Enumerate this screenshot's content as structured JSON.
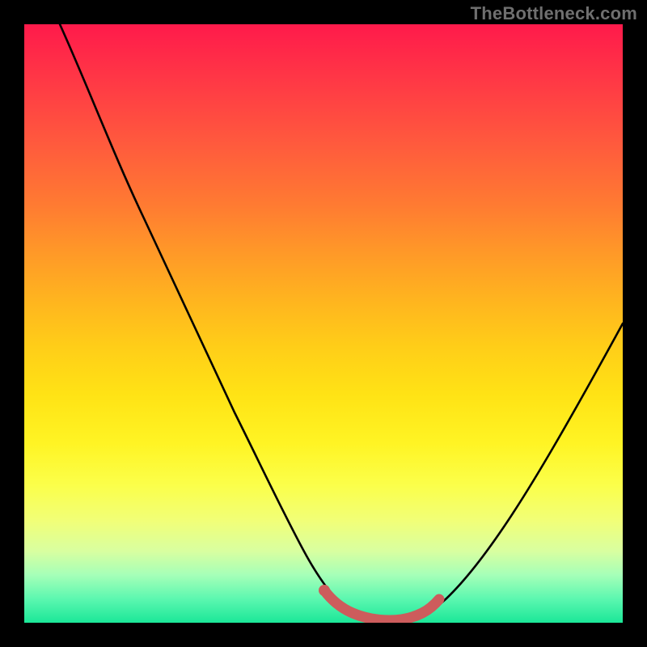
{
  "watermark": {
    "text": "TheBottleneck.com"
  },
  "chart_data": {
    "type": "line",
    "title": "",
    "xlabel": "",
    "ylabel": "",
    "xlim": [
      0,
      100
    ],
    "ylim": [
      0,
      100
    ],
    "grid": false,
    "legend": false,
    "gradient_stops": [
      {
        "pos": 0,
        "color": "#ff1a4b"
      },
      {
        "pos": 10,
        "color": "#ff3a45"
      },
      {
        "pos": 20,
        "color": "#ff5a3d"
      },
      {
        "pos": 30,
        "color": "#ff7a32"
      },
      {
        "pos": 38,
        "color": "#ff9828"
      },
      {
        "pos": 46,
        "color": "#ffb41f"
      },
      {
        "pos": 54,
        "color": "#ffce18"
      },
      {
        "pos": 62,
        "color": "#ffe315"
      },
      {
        "pos": 70,
        "color": "#fff424"
      },
      {
        "pos": 77,
        "color": "#fbff4a"
      },
      {
        "pos": 83,
        "color": "#f1ff78"
      },
      {
        "pos": 88,
        "color": "#d9ffa0"
      },
      {
        "pos": 92,
        "color": "#a6ffb8"
      },
      {
        "pos": 96,
        "color": "#5cf7b0"
      },
      {
        "pos": 100,
        "color": "#1be798"
      }
    ],
    "series": [
      {
        "name": "bottleneck-curve",
        "color": "#000000",
        "x": [
          6,
          10,
          15,
          20,
          25,
          30,
          35,
          40,
          45,
          48,
          50,
          53,
          56,
          60,
          62,
          66,
          70,
          75,
          80,
          85,
          90,
          95,
          100
        ],
        "values": [
          100,
          92,
          82,
          72,
          62,
          52,
          42,
          33,
          22,
          14,
          9,
          4,
          1,
          0,
          0,
          1,
          4,
          9,
          16,
          24,
          32,
          41,
          50
        ]
      },
      {
        "name": "highlight-band",
        "color": "#cd5c5c",
        "style": "thick-dotted",
        "x": [
          50,
          52,
          54,
          56,
          58,
          60,
          62,
          64,
          66
        ],
        "values": [
          4.5,
          3,
          2,
          1.2,
          1,
          1,
          1.2,
          2,
          3
        ]
      }
    ],
    "highlight_marker": {
      "x": 50,
      "y": 5,
      "color": "#cd5c5c"
    }
  }
}
